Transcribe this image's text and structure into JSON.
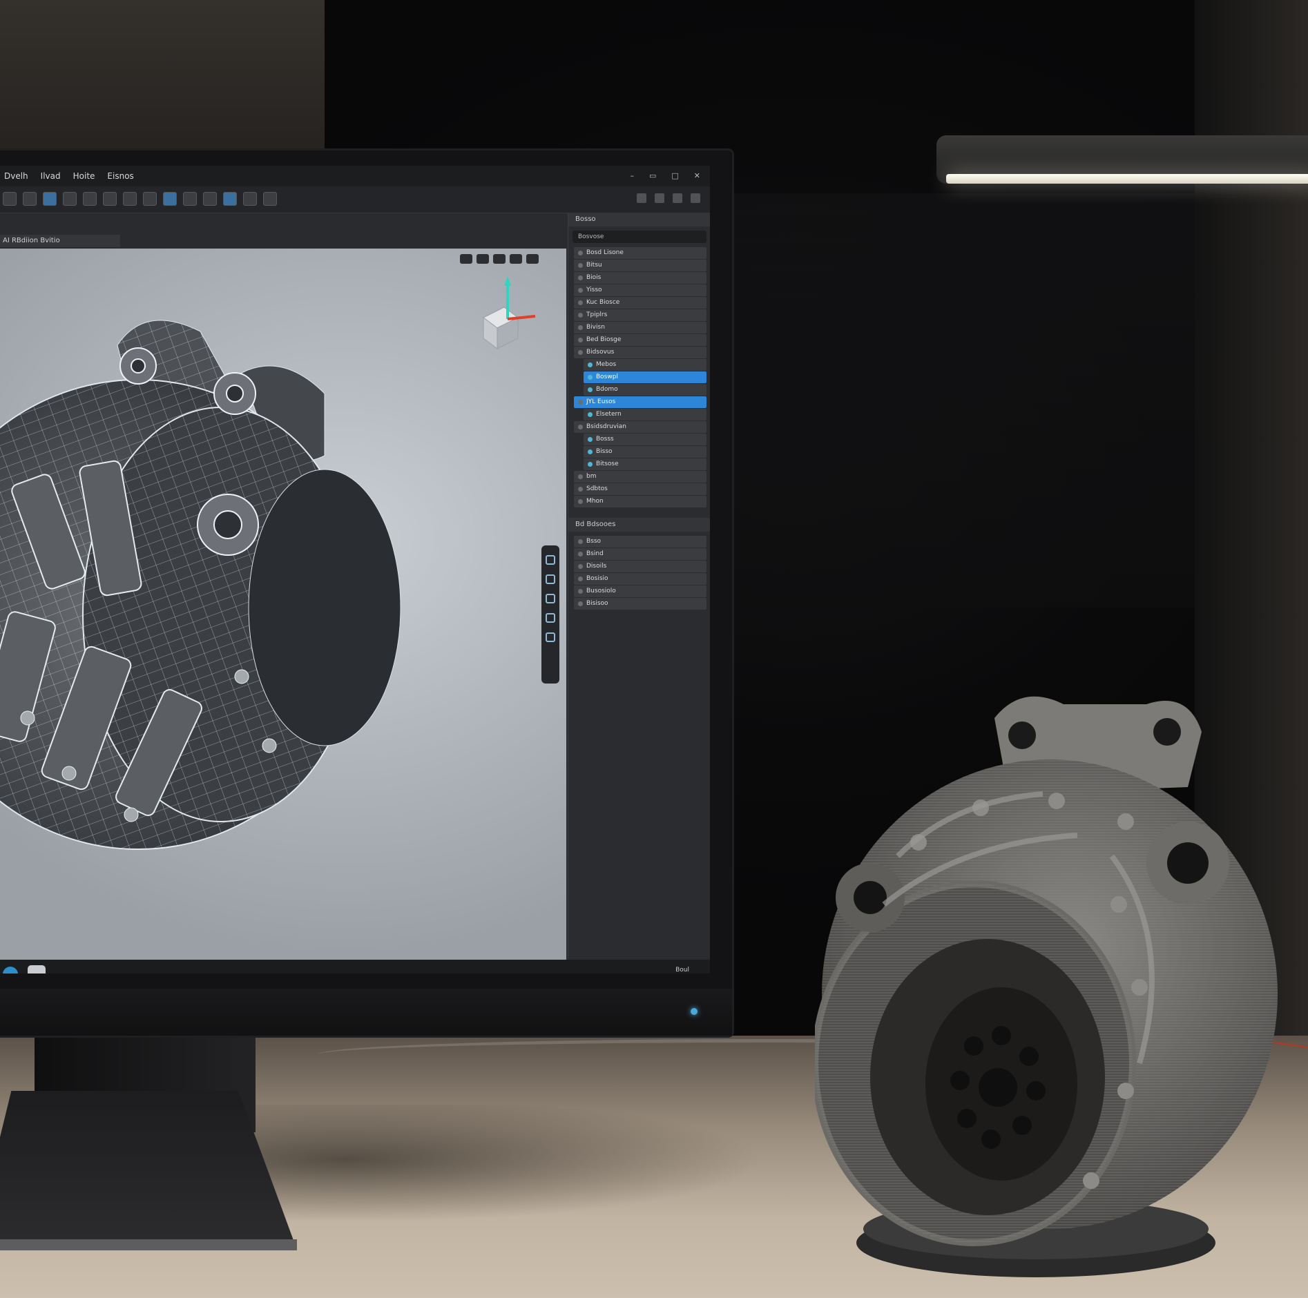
{
  "scene": {
    "description_tags": [
      "cad-monitor",
      "3d-printed-part",
      "desk-lamp"
    ],
    "colors": {
      "accent_blue": "#2e86d8",
      "viewport_bg": "#b8bec4",
      "print_gray": "#6e6c6a",
      "desk": "#c2b4a2"
    }
  },
  "cad": {
    "menu": [
      "Dvelh",
      "Ilvad",
      "Hoite",
      "Eisnos"
    ],
    "document_tab": "AI RBdiion Bvitio",
    "panel_header": "Bosso",
    "panel_search": "Bosvose",
    "tree": [
      {
        "label": "Bosd Lisone",
        "selected": false,
        "sub": false
      },
      {
        "label": "Bitsu",
        "selected": false,
        "sub": false
      },
      {
        "label": "Biois",
        "selected": false,
        "sub": false
      },
      {
        "label": "Yisso",
        "selected": false,
        "sub": false
      },
      {
        "label": "Kuc Biosce",
        "selected": false,
        "sub": false
      },
      {
        "label": "Tpiplrs",
        "selected": false,
        "sub": false
      },
      {
        "label": "Bivisn",
        "selected": false,
        "sub": false
      },
      {
        "label": "Bed Biosge",
        "selected": false,
        "sub": false
      },
      {
        "label": "Bidsovus",
        "selected": false,
        "sub": false
      },
      {
        "label": "Mebos",
        "selected": false,
        "sub": true
      },
      {
        "label": "Boswpl",
        "selected": true,
        "sub": true
      },
      {
        "label": "Bdomo",
        "selected": false,
        "sub": true
      },
      {
        "label": "JYL Eusos",
        "selected": true,
        "sub": false
      },
      {
        "label": "Elsetern",
        "selected": false,
        "sub": true
      },
      {
        "label": "Bsidsdruvian",
        "selected": false,
        "sub": false
      },
      {
        "label": "Bosss",
        "selected": false,
        "sub": true
      },
      {
        "label": "Bisso",
        "selected": false,
        "sub": true
      },
      {
        "label": "Bitsose",
        "selected": false,
        "sub": true
      },
      {
        "label": "bm",
        "selected": false,
        "sub": false
      },
      {
        "label": "Sdbtos",
        "selected": false,
        "sub": false
      },
      {
        "label": "Mhon",
        "selected": false,
        "sub": false
      }
    ],
    "tree2_header": "Bd Bdsooes",
    "tree2": [
      "Bsso",
      "Bsind",
      "Disoils",
      "Bosisio",
      "Busosiolo",
      "Bisisoo"
    ],
    "tray_text": "Boul"
  }
}
